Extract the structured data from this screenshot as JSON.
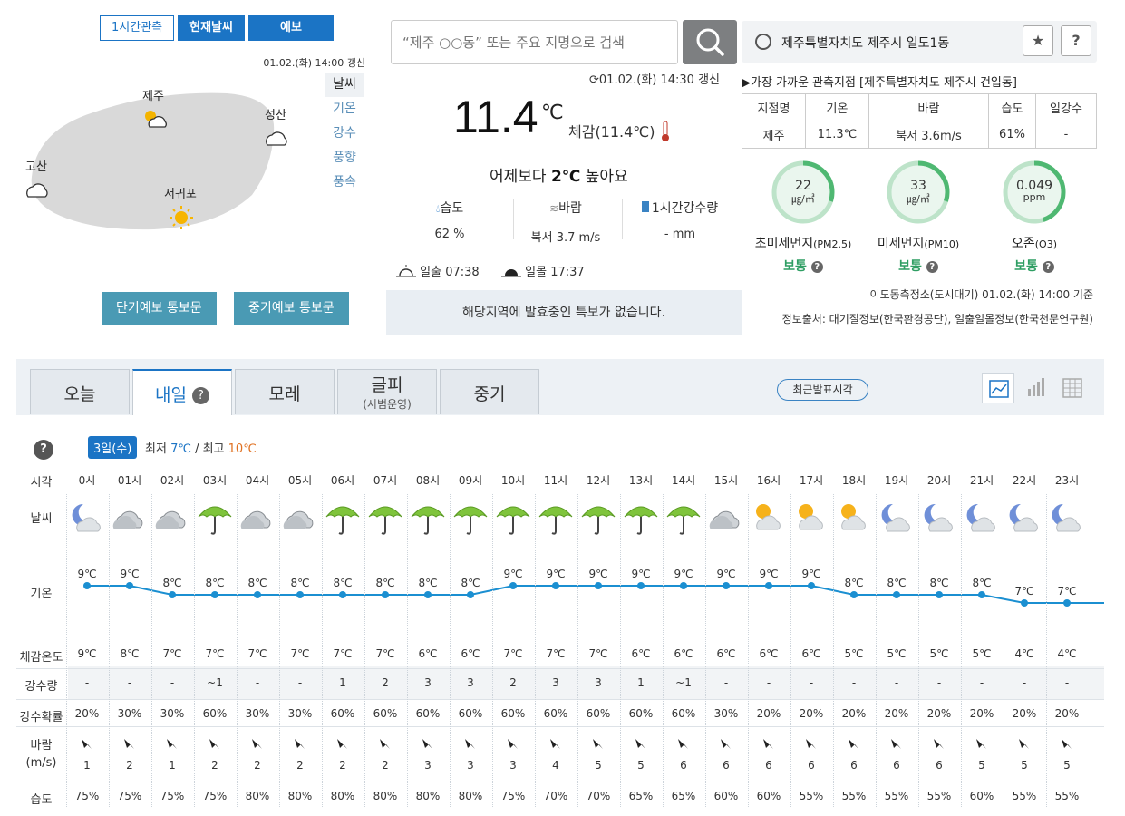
{
  "obs_tabs": [
    "1시간관측",
    "현재날씨",
    "예보"
  ],
  "map": {
    "updated": "01.02.(화) 14:00 갱신",
    "menu": [
      "날씨",
      "기온",
      "강수",
      "풍향",
      "풍속"
    ],
    "cities": [
      {
        "name": "제주",
        "icon": "sun-cloud-icon"
      },
      {
        "name": "성산",
        "icon": "cloud-icon"
      },
      {
        "name": "고산",
        "icon": "cloud-icon"
      },
      {
        "name": "서귀포",
        "icon": "sun-icon"
      }
    ],
    "buttons": [
      "단기예보 통보문",
      "중기예보 통보문"
    ]
  },
  "search": {
    "placeholder": "“제주 ○○동” 또는 주요 지명으로 검색"
  },
  "current": {
    "updated": "01.02.(화) 14:30 갱신",
    "temp": "11.4",
    "unit": "℃",
    "feel": "체감(11.4℃)",
    "compare_pre": "어제보다 ",
    "compare_val": "2℃",
    "compare_post": " 높아요",
    "humidity_label": "습도",
    "humidity": "62 %",
    "wind_label": "바람",
    "wind": "북서 3.7 m/s",
    "rain_label": "1시간강수량",
    "rain": "- mm",
    "sunrise_label": "일출",
    "sunrise": "07:38",
    "sunset_label": "일몰",
    "sunset": "17:37",
    "alert": "해당지역에 발효중인 특보가 없습니다."
  },
  "location": {
    "name": "제주특별자치도 제주시 일도1동",
    "nearest": "▶가장 가까운 관측지점 [제주특별자치도 제주시 건입동]",
    "table_headers": [
      "지점명",
      "기온",
      "바람",
      "습도",
      "일강수"
    ],
    "table_values": [
      "제주",
      "11.3℃",
      "북서 3.6m/s",
      "61%",
      "-"
    ]
  },
  "air": [
    {
      "value": "22",
      "unit": "㎍/㎥",
      "label": "초미세먼지",
      "sub": "(PM2.5)",
      "status": "보통",
      "fill": 0.3
    },
    {
      "value": "33",
      "unit": "㎍/㎥",
      "label": "미세먼지",
      "sub": "(PM10)",
      "status": "보통",
      "fill": 0.3
    },
    {
      "value": "0.049",
      "unit": "ppm",
      "label": "오존",
      "sub": "(O3)",
      "status": "보통",
      "fill": 0.45
    }
  ],
  "air_time": "이도동측정소(도시대기) 01.02.(화) 14:00 기준",
  "source": "정보출처: 대기질정보(한국환경공단), 일출일몰정보(한국천문연구원)",
  "forecast": {
    "tabs": [
      {
        "label": "오늘",
        "sub": ""
      },
      {
        "label": "내일",
        "sub": ""
      },
      {
        "label": "모레",
        "sub": ""
      },
      {
        "label": "글피",
        "sub": "(시범운영)"
      },
      {
        "label": "중기",
        "sub": ""
      }
    ],
    "recent_btn": "최근발표시각",
    "date": "3일(수)",
    "min_label": "최저",
    "min": "7℃",
    "max_label": "최고",
    "max": "10℃",
    "row_labels": [
      "시각",
      "날씨",
      "기온",
      "체감온도",
      "강수량",
      "강수확률",
      "바람\n(m/s)",
      "습도"
    ],
    "hours": [
      "0시",
      "01시",
      "02시",
      "03시",
      "04시",
      "05시",
      "06시",
      "07시",
      "08시",
      "09시",
      "10시",
      "11시",
      "12시",
      "13시",
      "14시",
      "15시",
      "16시",
      "17시",
      "18시",
      "19시",
      "20시",
      "21시",
      "22시",
      "23시"
    ],
    "weather": [
      "moon-cloud",
      "cloud",
      "cloud",
      "umbrella",
      "cloud",
      "cloud",
      "umbrella",
      "umbrella",
      "umbrella",
      "umbrella",
      "umbrella",
      "umbrella",
      "umbrella",
      "umbrella",
      "umbrella",
      "cloud",
      "sun-cloud",
      "sun-cloud",
      "sun-cloud",
      "moon-cloud",
      "moon-cloud",
      "moon-cloud",
      "moon-cloud",
      "moon-cloud"
    ],
    "temps": [
      9,
      9,
      8,
      8,
      8,
      8,
      8,
      8,
      8,
      8,
      9,
      9,
      9,
      9,
      9,
      9,
      9,
      9,
      8,
      8,
      8,
      8,
      7,
      7
    ],
    "feels": [
      "9℃",
      "8℃",
      "7℃",
      "7℃",
      "7℃",
      "7℃",
      "7℃",
      "7℃",
      "6℃",
      "6℃",
      "7℃",
      "7℃",
      "7℃",
      "6℃",
      "6℃",
      "6℃",
      "6℃",
      "6℃",
      "5℃",
      "5℃",
      "5℃",
      "5℃",
      "4℃",
      "4℃"
    ],
    "rain": [
      "-",
      "-",
      "-",
      "~1",
      "-",
      "-",
      "1",
      "2",
      "3",
      "3",
      "2",
      "3",
      "3",
      "1",
      "~1",
      "-",
      "-",
      "-",
      "-",
      "-",
      "-",
      "-",
      "-",
      "-"
    ],
    "pop": [
      "20%",
      "30%",
      "30%",
      "60%",
      "30%",
      "30%",
      "60%",
      "60%",
      "60%",
      "60%",
      "60%",
      "60%",
      "60%",
      "60%",
      "60%",
      "30%",
      "20%",
      "20%",
      "20%",
      "20%",
      "20%",
      "20%",
      "20%",
      "20%"
    ],
    "wind": [
      "1",
      "2",
      "1",
      "2",
      "2",
      "2",
      "2",
      "2",
      "3",
      "3",
      "3",
      "4",
      "5",
      "5",
      "6",
      "6",
      "6",
      "6",
      "6",
      "6",
      "6",
      "5",
      "5",
      "5"
    ],
    "humidity": [
      "75%",
      "75%",
      "75%",
      "75%",
      "80%",
      "80%",
      "80%",
      "80%",
      "80%",
      "80%",
      "75%",
      "70%",
      "70%",
      "65%",
      "65%",
      "60%",
      "60%",
      "55%",
      "55%",
      "55%",
      "55%",
      "60%",
      "55%",
      "55%"
    ]
  }
}
